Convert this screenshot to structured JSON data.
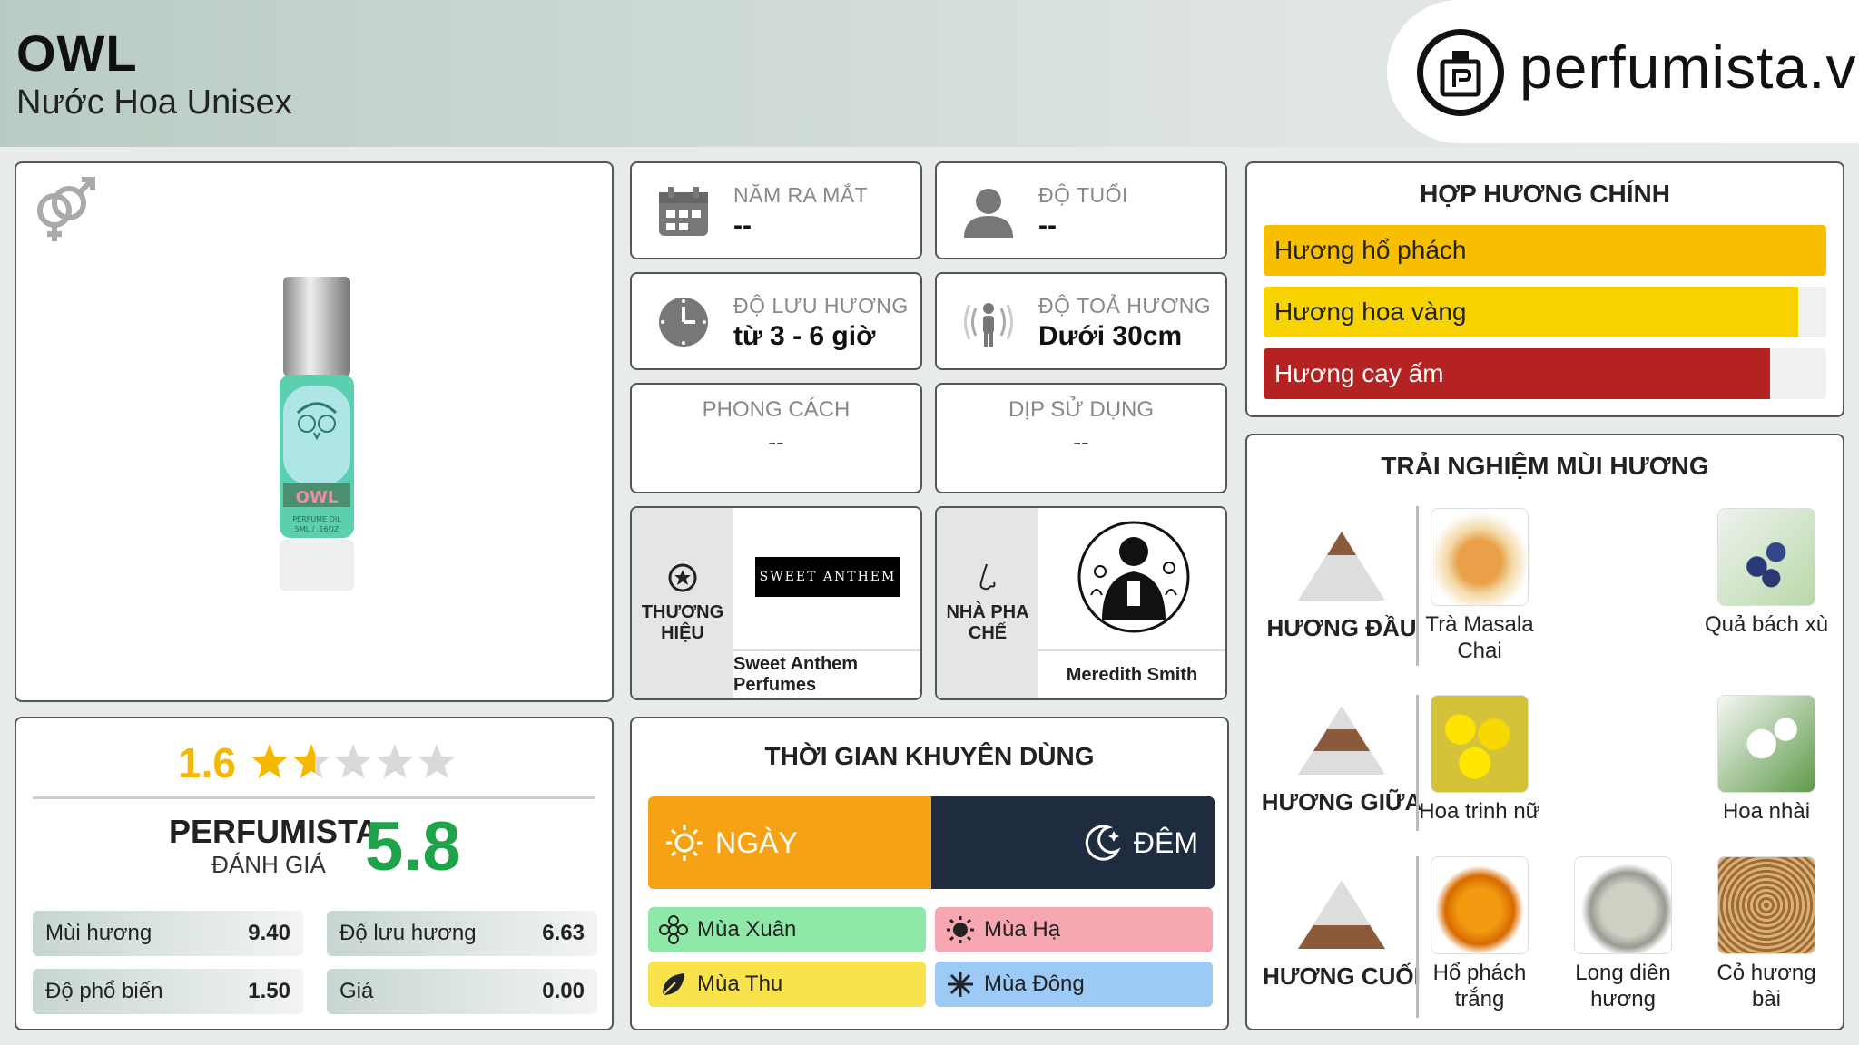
{
  "header": {
    "title": "OWL",
    "subtitle": "Nước Hoa Unisex",
    "logo_text": "perfumista.vn"
  },
  "product": {
    "bottle_label": "OWL",
    "bottle_sub": "PERFUME OIL",
    "bottle_size": "5ML / .16OZ"
  },
  "rating": {
    "value": "1.6",
    "stars_fraction": 0.32,
    "perfumista_label": "PERFUMISTA",
    "perfumista_sub": "ĐÁNH GIÁ",
    "perfumista_score": "5.8",
    "stats": [
      {
        "label": "Mùi hương",
        "value": "9.40"
      },
      {
        "label": "Độ lưu hương",
        "value": "6.63"
      },
      {
        "label": "Độ phổ biến",
        "value": "1.50"
      },
      {
        "label": "Giá",
        "value": "0.00"
      }
    ]
  },
  "info": {
    "release": {
      "label": "NĂM RA MẮT",
      "value": "--",
      "icon": "calendar-icon"
    },
    "age": {
      "label": "ĐỘ TUỔI",
      "value": "--",
      "icon": "person-icon"
    },
    "longevity": {
      "label": "ĐỘ LƯU HƯƠNG",
      "value": "từ 3 - 6 giờ",
      "icon": "clock-icon"
    },
    "sillage": {
      "label": "ĐỘ TOẢ HƯƠNG",
      "value": "Dưới 30cm",
      "icon": "sillage-icon"
    },
    "style": {
      "label": "PHONG CÁCH",
      "value": "--"
    },
    "occasion": {
      "label": "DỊP SỬ DỤNG",
      "value": "--"
    },
    "brand": {
      "label_line1": "THƯƠNG",
      "label_line2": "HIỆU",
      "logo_text": "SWEET ANTHEM",
      "name": "Sweet Anthem Perfumes"
    },
    "perfumer": {
      "label_line1": "NHÀ PHA",
      "label_line2": "CHẾ",
      "name": "Meredith Smith"
    }
  },
  "time": {
    "title": "THỜI GIAN KHUYÊN DÙNG",
    "day": "NGÀY",
    "night": "ĐÊM",
    "colors": {
      "day": "#f5a315",
      "night": "#1f2b3e"
    },
    "seasons": [
      {
        "label": "Mùa Xuân",
        "color": "#8ee8a8"
      },
      {
        "label": "Mùa Hạ",
        "color": "#f7a7b2"
      },
      {
        "label": "Mùa Thu",
        "color": "#f9e34c"
      },
      {
        "label": "Mùa Đông",
        "color": "#9ccaf5"
      }
    ]
  },
  "accords": {
    "title": "HỢP HƯƠNG CHÍNH",
    "items": [
      {
        "label": "Hương hổ phách",
        "fraction": 1.0,
        "color": "#f7bf00",
        "text_color": "#222"
      },
      {
        "label": "Hương hoa vàng",
        "fraction": 0.95,
        "color": "#f7d300",
        "text_color": "#222"
      },
      {
        "label": "Hương cay ấm",
        "fraction": 0.9,
        "color": "#b52222",
        "text_color": "#fff"
      }
    ]
  },
  "notes": {
    "title": "TRẢI NGHIỆM MÙI HƯƠNG",
    "top": {
      "label": "HƯƠNG ĐẦU",
      "items": [
        "Trà Masala Chai",
        "Quả bách xù"
      ]
    },
    "middle": {
      "label": "HƯƠNG GIỮA",
      "items": [
        "Hoa trinh nữ",
        "Hoa nhài"
      ]
    },
    "base": {
      "label": "HƯƠNG CUỐI",
      "items": [
        "Hổ phách trắng",
        "Long diên hương",
        "Cỏ hương bài"
      ]
    }
  }
}
